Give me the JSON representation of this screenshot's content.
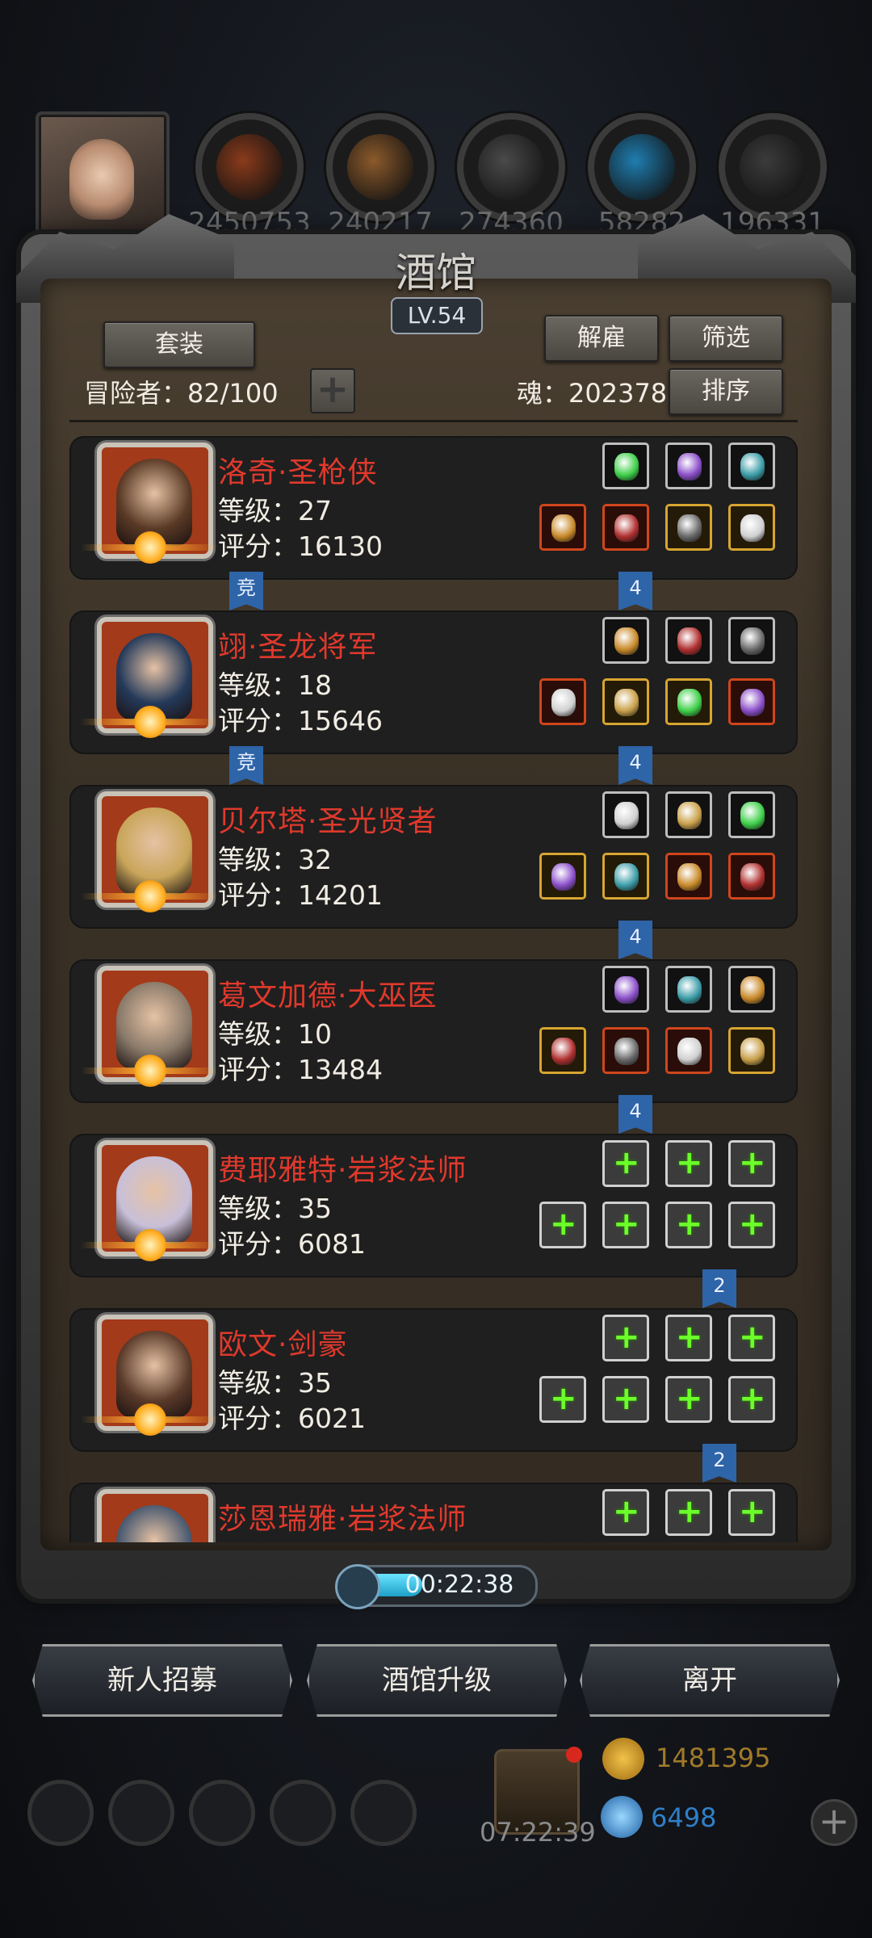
{
  "top_bar": {
    "resources": [
      {
        "name": "meat-resource-icon",
        "value": "2450753",
        "color": "#8a3b1b"
      },
      {
        "name": "wood-resource-icon",
        "value": "240217",
        "color": "#8b5a2b"
      },
      {
        "name": "iron-resource-icon",
        "value": "274360",
        "color": "#4a4a4a"
      },
      {
        "name": "crystal-resource-icon",
        "value": "58282",
        "color": "#1f7db0"
      },
      {
        "name": "stone-resource-icon",
        "value": "196331",
        "color": "#3b3b3b"
      }
    ]
  },
  "panel": {
    "title": "酒馆",
    "level": "LV.54",
    "suit_button": "套装",
    "dismiss_button": "解雇",
    "filter_button": "筛选",
    "sort_button": "排序",
    "adventurers_label": "冒险者：82/100",
    "soul_label": "魂：202378",
    "plus": "+"
  },
  "heroes": [
    {
      "name": "洛奇·圣枪侠",
      "level": "等级：27",
      "score": "评分：16130",
      "tag_left": "竞",
      "tag_right": "4",
      "portrait_color": "#5a3a26",
      "equipped": true
    },
    {
      "name": "翊·圣龙将军",
      "level": "等级：18",
      "score": "评分：15646",
      "tag_left": "竞",
      "tag_right": "4",
      "portrait_color": "#243a5a",
      "equipped": true
    },
    {
      "name": "贝尔塔·圣光贤者",
      "level": "等级：32",
      "score": "评分：14201",
      "tag_left": "",
      "tag_right": "4",
      "portrait_color": "#c9a65a",
      "equipped": true
    },
    {
      "name": "葛文加德·大巫医",
      "level": "等级：10",
      "score": "评分：13484",
      "tag_left": "",
      "tag_right": "4",
      "portrait_color": "#8a7a6a",
      "equipped": true
    },
    {
      "name": "费耶雅特·岩浆法师",
      "level": "等级：35",
      "score": "评分：6081",
      "tag_left": "",
      "tag_right": "2",
      "portrait_color": "#c8c0d8",
      "equipped": false
    },
    {
      "name": "欧文·剑豪",
      "level": "等级：35",
      "score": "评分：6021",
      "tag_left": "",
      "tag_right": "2",
      "portrait_color": "#5a3a2a",
      "equipped": false
    },
    {
      "name": "莎恩瑞雅·岩浆法师",
      "level": "",
      "score": "",
      "tag_left": "",
      "tag_right": "",
      "portrait_color": "#4a5a70",
      "equipped": false
    }
  ],
  "timer": {
    "value": "00:22:38"
  },
  "buttons": {
    "recruit": "新人招募",
    "upgrade": "酒馆升级",
    "leave": "离开"
  },
  "footer": {
    "gift_timer": "07:22:39",
    "gold": "1481395",
    "gems": "6498"
  },
  "colors": {
    "hero_name": "#e0392c",
    "accent_green": "#6cff2a",
    "tag_blue": "#2e64a8",
    "gold_text": "#a07a2a",
    "gem_text": "#2f7fc9"
  }
}
